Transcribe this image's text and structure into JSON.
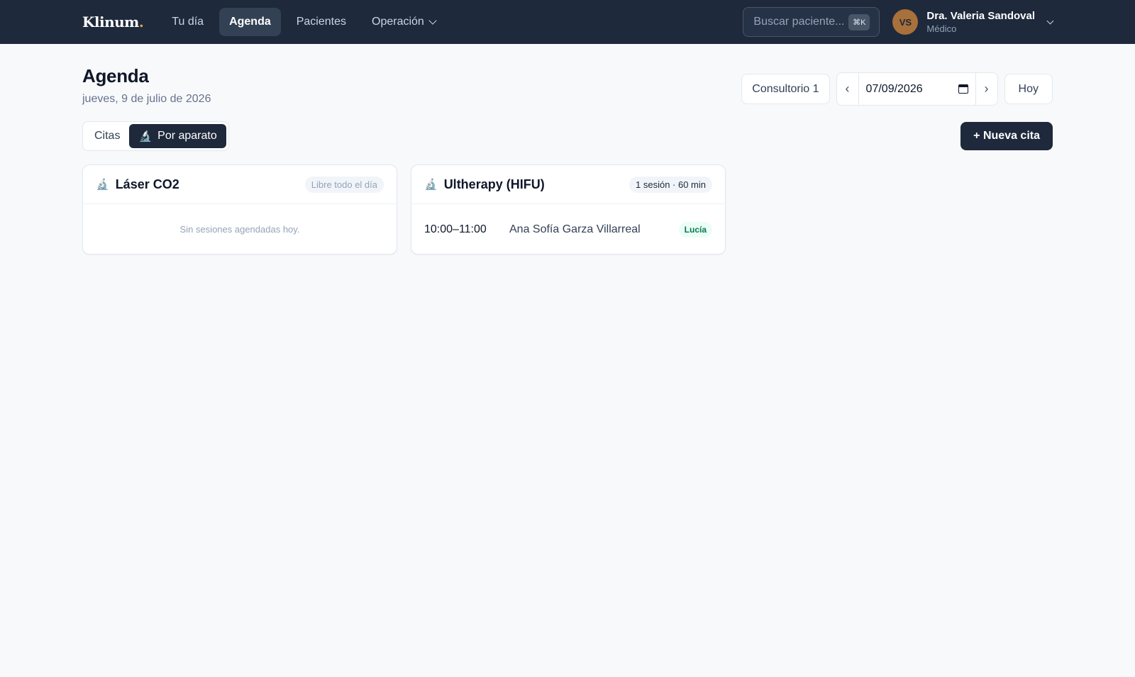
{
  "nav": {
    "logo_text": "Klinum",
    "logo_dot": ".",
    "links": [
      {
        "label": "Tu día"
      },
      {
        "label": "Agenda"
      },
      {
        "label": "Pacientes"
      },
      {
        "label": "Operación"
      }
    ],
    "search_placeholder": "Buscar paciente...",
    "search_shortcut": "⌘K",
    "user": {
      "initials": "VS",
      "name": "Dra. Valeria Sandoval",
      "role": "Médico"
    }
  },
  "header": {
    "title": "Agenda",
    "date_long": "jueves, 9 de julio de 2026",
    "room_label": "Consultorio 1",
    "prev_label": "‹",
    "date_value": "07/09/2026",
    "next_label": "›",
    "today_label": "Hoy"
  },
  "toolbar": {
    "view_citas": "Citas",
    "view_aparato": "Por aparato",
    "new_label": "+ Nueva cita"
  },
  "devices": [
    {
      "name": "Láser CO2",
      "badge": "Libre todo el día",
      "empty_text": "Sin sesiones agendadas hoy."
    },
    {
      "name": "Ultherapy (HIFU)",
      "badge": "1 sesión · 60 min",
      "session": {
        "time": "10:00–11:00",
        "patient": "Ana Sofía Garza Villarreal",
        "staff": "Lucía"
      }
    }
  ],
  "icons": {
    "device": "microscope-icon",
    "calendar": "calendar-icon",
    "chevron": "chevron-down-icon"
  },
  "colors": {
    "nav_bg": "#1e293b",
    "accent_dot": "#e2a04a",
    "avatar": "#a8703a",
    "staff_badge": "#047857"
  }
}
